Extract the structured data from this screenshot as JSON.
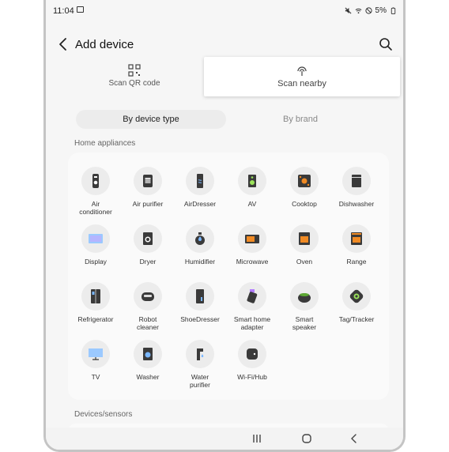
{
  "status": {
    "time": "11:04",
    "battery": "5%"
  },
  "header": {
    "title": "Add device"
  },
  "scan": {
    "qr_label": "Scan QR code",
    "nearby_label": "Scan nearby"
  },
  "filter": {
    "by_type": "By device type",
    "by_brand": "By brand"
  },
  "sections": {
    "home_appliances": "Home appliances",
    "devices_sensors": "Devices/sensors"
  },
  "devices": [
    {
      "label": "Air\nconditioner",
      "icon": "air-conditioner-icon"
    },
    {
      "label": "Air purifier",
      "icon": "air-purifier-icon"
    },
    {
      "label": "AirDresser",
      "icon": "airdresser-icon"
    },
    {
      "label": "AV",
      "icon": "speaker-icon"
    },
    {
      "label": "Cooktop",
      "icon": "cooktop-icon"
    },
    {
      "label": "Dishwasher",
      "icon": "dishwasher-icon"
    },
    {
      "label": "Display",
      "icon": "display-icon"
    },
    {
      "label": "Dryer",
      "icon": "dryer-icon"
    },
    {
      "label": "Humidifier",
      "icon": "humidifier-icon"
    },
    {
      "label": "Microwave",
      "icon": "microwave-icon"
    },
    {
      "label": "Oven",
      "icon": "oven-icon"
    },
    {
      "label": "Range",
      "icon": "range-icon"
    },
    {
      "label": "Refrigerator",
      "icon": "refrigerator-icon"
    },
    {
      "label": "Robot\ncleaner",
      "icon": "robot-cleaner-icon"
    },
    {
      "label": "ShoeDresser",
      "icon": "shoedresser-icon"
    },
    {
      "label": "Smart home\nadapter",
      "icon": "smart-home-adapter-icon"
    },
    {
      "label": "Smart\nspeaker",
      "icon": "smart-speaker-icon"
    },
    {
      "label": "Tag/Tracker",
      "icon": "tag-tracker-icon"
    },
    {
      "label": "TV",
      "icon": "tv-icon"
    },
    {
      "label": "Washer",
      "icon": "washer-icon"
    },
    {
      "label": "Water\npurifier",
      "icon": "water-purifier-icon"
    },
    {
      "label": "Wi-Fi/Hub",
      "icon": "wifi-hub-icon"
    }
  ],
  "colors": {
    "accent_orange": "#f08a24",
    "accent_blue": "#2f7de0",
    "accent_green": "#5ca832",
    "dark": "#3a3a3a"
  }
}
